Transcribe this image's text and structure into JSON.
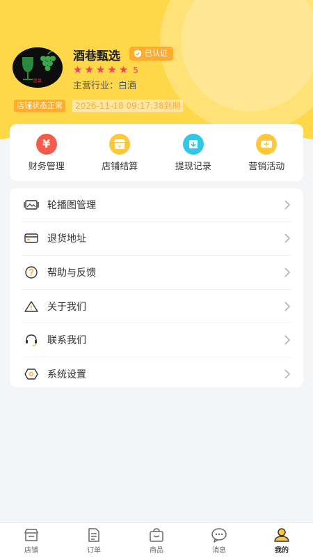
{
  "shop": {
    "name": "酒巷甄选",
    "verified_label": "已认证",
    "rating": 5,
    "rating_text": "5",
    "industry_label": "主营行业：",
    "industry_value": "白酒",
    "status_badge": "店铺状态正常",
    "expire_text": "2026-11-18 09:17:38到期",
    "logo_text": "胜慕"
  },
  "quick_actions": [
    {
      "label": "财务管理",
      "icon": "yuan-icon",
      "color": "#f25c4a"
    },
    {
      "label": "店铺结算",
      "icon": "shop-settle-icon",
      "color": "#ffc83a"
    },
    {
      "label": "提现记录",
      "icon": "withdraw-icon",
      "color": "#30c8e8"
    },
    {
      "label": "营销活动",
      "icon": "marketing-icon",
      "color": "#ffc83a"
    }
  ],
  "menu": [
    {
      "label": "轮播图管理",
      "icon": "carousel-icon"
    },
    {
      "label": "退货地址",
      "icon": "address-card-icon"
    },
    {
      "label": "帮助与反馈",
      "icon": "help-icon"
    },
    {
      "label": "关于我们",
      "icon": "warning-triangle-icon"
    },
    {
      "label": "联系我们",
      "icon": "headset-icon"
    },
    {
      "label": "系统设置",
      "icon": "settings-hexagon-icon"
    }
  ],
  "tabs": [
    {
      "label": "店铺",
      "icon": "store-icon",
      "active": false
    },
    {
      "label": "订单",
      "icon": "order-icon",
      "active": false
    },
    {
      "label": "商品",
      "icon": "goods-bag-icon",
      "active": false
    },
    {
      "label": "消息",
      "icon": "message-icon",
      "active": false
    },
    {
      "label": "我的",
      "icon": "user-icon",
      "active": true
    }
  ],
  "colors": {
    "header_bg": "#ffd84a",
    "accent": "#ffab2e",
    "star": "#f2435b"
  }
}
